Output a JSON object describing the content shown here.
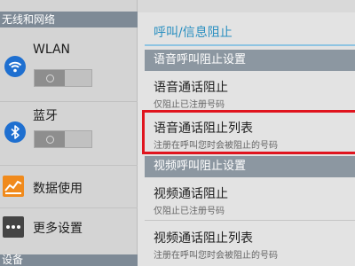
{
  "left": {
    "section_header": "无线和网络",
    "section_header_bottom": "设备",
    "items": [
      {
        "label": "WLAN",
        "icon": "wifi-icon"
      },
      {
        "label": "蓝牙",
        "icon": "bluetooth-icon"
      },
      {
        "label": "数据使用",
        "icon": "data-usage-icon"
      },
      {
        "label": "更多设置",
        "icon": "more-settings-icon"
      }
    ],
    "wlan_toggle_on": false,
    "bluetooth_toggle_on": false
  },
  "right": {
    "title": "呼叫/信息阻止",
    "sections": [
      {
        "header": "语音呼叫阻止设置",
        "items": [
          {
            "title": "语音通话阻止",
            "subtitle": "仅阻止已注册号码"
          },
          {
            "title": "语音通话阻止列表",
            "subtitle": "注册在呼叫您时会被阻止的号码"
          }
        ]
      },
      {
        "header": "视频呼叫阻止设置",
        "items": [
          {
            "title": "视频通话阻止",
            "subtitle": "仅阻止已注册号码"
          },
          {
            "title": "视频通话阻止列表",
            "subtitle": "注册在呼叫您时会被阻止的号码"
          }
        ]
      }
    ]
  },
  "colors": {
    "accent": "#2a8fc0",
    "highlight": "#e0141e",
    "section_header": "#8c97a1",
    "wifi_icon": "#1e6fd0",
    "bluetooth_icon": "#1e6fd0",
    "data_icon": "#f08a1c",
    "more_icon": "#444444"
  }
}
